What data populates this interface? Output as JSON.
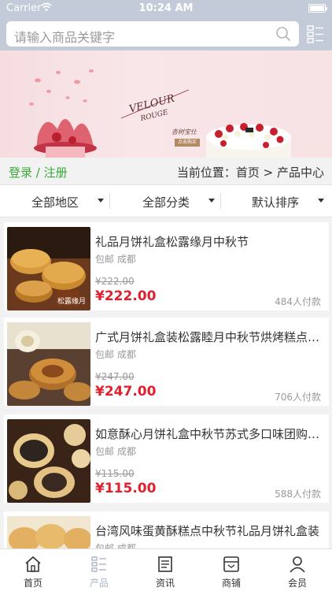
{
  "status_bar": {
    "carrier": "Carrier",
    "time": "10:24 AM"
  },
  "search": {
    "placeholder": "请输入商品关键字"
  },
  "banner": {
    "brand_line1": "VELOUR",
    "brand_line2": "ROUGE",
    "brand_sub": "杏树宝仕",
    "brand_tag": "点击购买"
  },
  "breadcrumb": {
    "login_label": "登录 / 注册",
    "location": "当前位置：首页 > 产品中心"
  },
  "filters": [
    {
      "label": "全部地区"
    },
    {
      "label": "全部分类"
    },
    {
      "label": "默认排序"
    }
  ],
  "products": [
    {
      "title": "礼品月饼礼盒松露缘月中秋节",
      "ship": "包邮 成都",
      "old_price": "¥222.00",
      "price": "¥222.00",
      "sold": "484人付款",
      "thumb_label": "松露缘月"
    },
    {
      "title": "广式月饼礼盒装松露睦月中秋节烘烤糕点…",
      "ship": "包邮 成都",
      "old_price": "¥247.00",
      "price": "¥247.00",
      "sold": "706人付款",
      "thumb_label": ""
    },
    {
      "title": "如意酥心月饼礼盒中秋节苏式多口味团购…",
      "ship": "包邮 成都",
      "old_price": "¥115.00",
      "price": "¥115.00",
      "sold": "588人付款",
      "thumb_label": ""
    },
    {
      "title": "台湾风味蛋黄酥糕点中秋节礼品月饼礼盒装",
      "ship": "包邮 成都",
      "old_price": "",
      "price": "",
      "sold": "",
      "thumb_label": ""
    }
  ],
  "tabbar": [
    {
      "label": "首页",
      "icon": "home-icon"
    },
    {
      "label": "产品",
      "icon": "list-icon",
      "active": true
    },
    {
      "label": "资讯",
      "icon": "news-icon"
    },
    {
      "label": "商铺",
      "icon": "store-icon"
    },
    {
      "label": "会员",
      "icon": "user-icon"
    }
  ],
  "colors": {
    "accent_green": "#3aa83a",
    "price_red": "#e0202e",
    "header_bg": "#c3cad8",
    "active_tab": "#aab4c6"
  }
}
